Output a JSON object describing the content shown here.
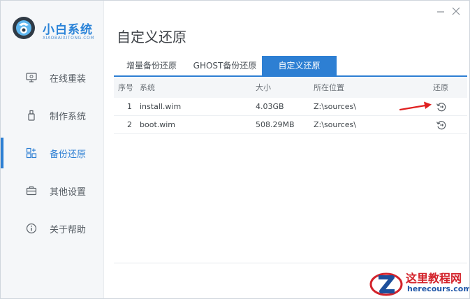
{
  "app": {
    "logo_text": "小白系统",
    "logo_sub": "XIAOBAIXITONG.COM",
    "page_title": "自定义还原"
  },
  "sidebar": {
    "items": [
      {
        "label": "在线重装",
        "icon": "monitor-icon",
        "active": false
      },
      {
        "label": "制作系统",
        "icon": "usb-icon",
        "active": false
      },
      {
        "label": "备份还原",
        "icon": "backup-icon",
        "active": true
      },
      {
        "label": "其他设置",
        "icon": "briefcase-icon",
        "active": false
      },
      {
        "label": "关于帮助",
        "icon": "info-icon",
        "active": false
      }
    ]
  },
  "tabs": [
    {
      "label": "增量备份还原",
      "active": false
    },
    {
      "label": "GHOST备份还原",
      "active": false
    },
    {
      "label": "自定义还原",
      "active": true
    }
  ],
  "table": {
    "headers": [
      "序号",
      "系统",
      "大小",
      "所在位置",
      "还原"
    ],
    "rows": [
      {
        "index": "1",
        "name": "install.wim",
        "size": "4.03GB",
        "location": "Z:\\sources\\"
      },
      {
        "index": "2",
        "name": "boot.wim",
        "size": "508.29MB",
        "location": "Z:\\sources\\"
      }
    ]
  },
  "watermark": {
    "title": "这里教程网",
    "url": "herecours.com"
  },
  "colors": {
    "accent": "#2d7fd3",
    "arrow": "#e02020",
    "watermark_red": "#d3232b"
  }
}
